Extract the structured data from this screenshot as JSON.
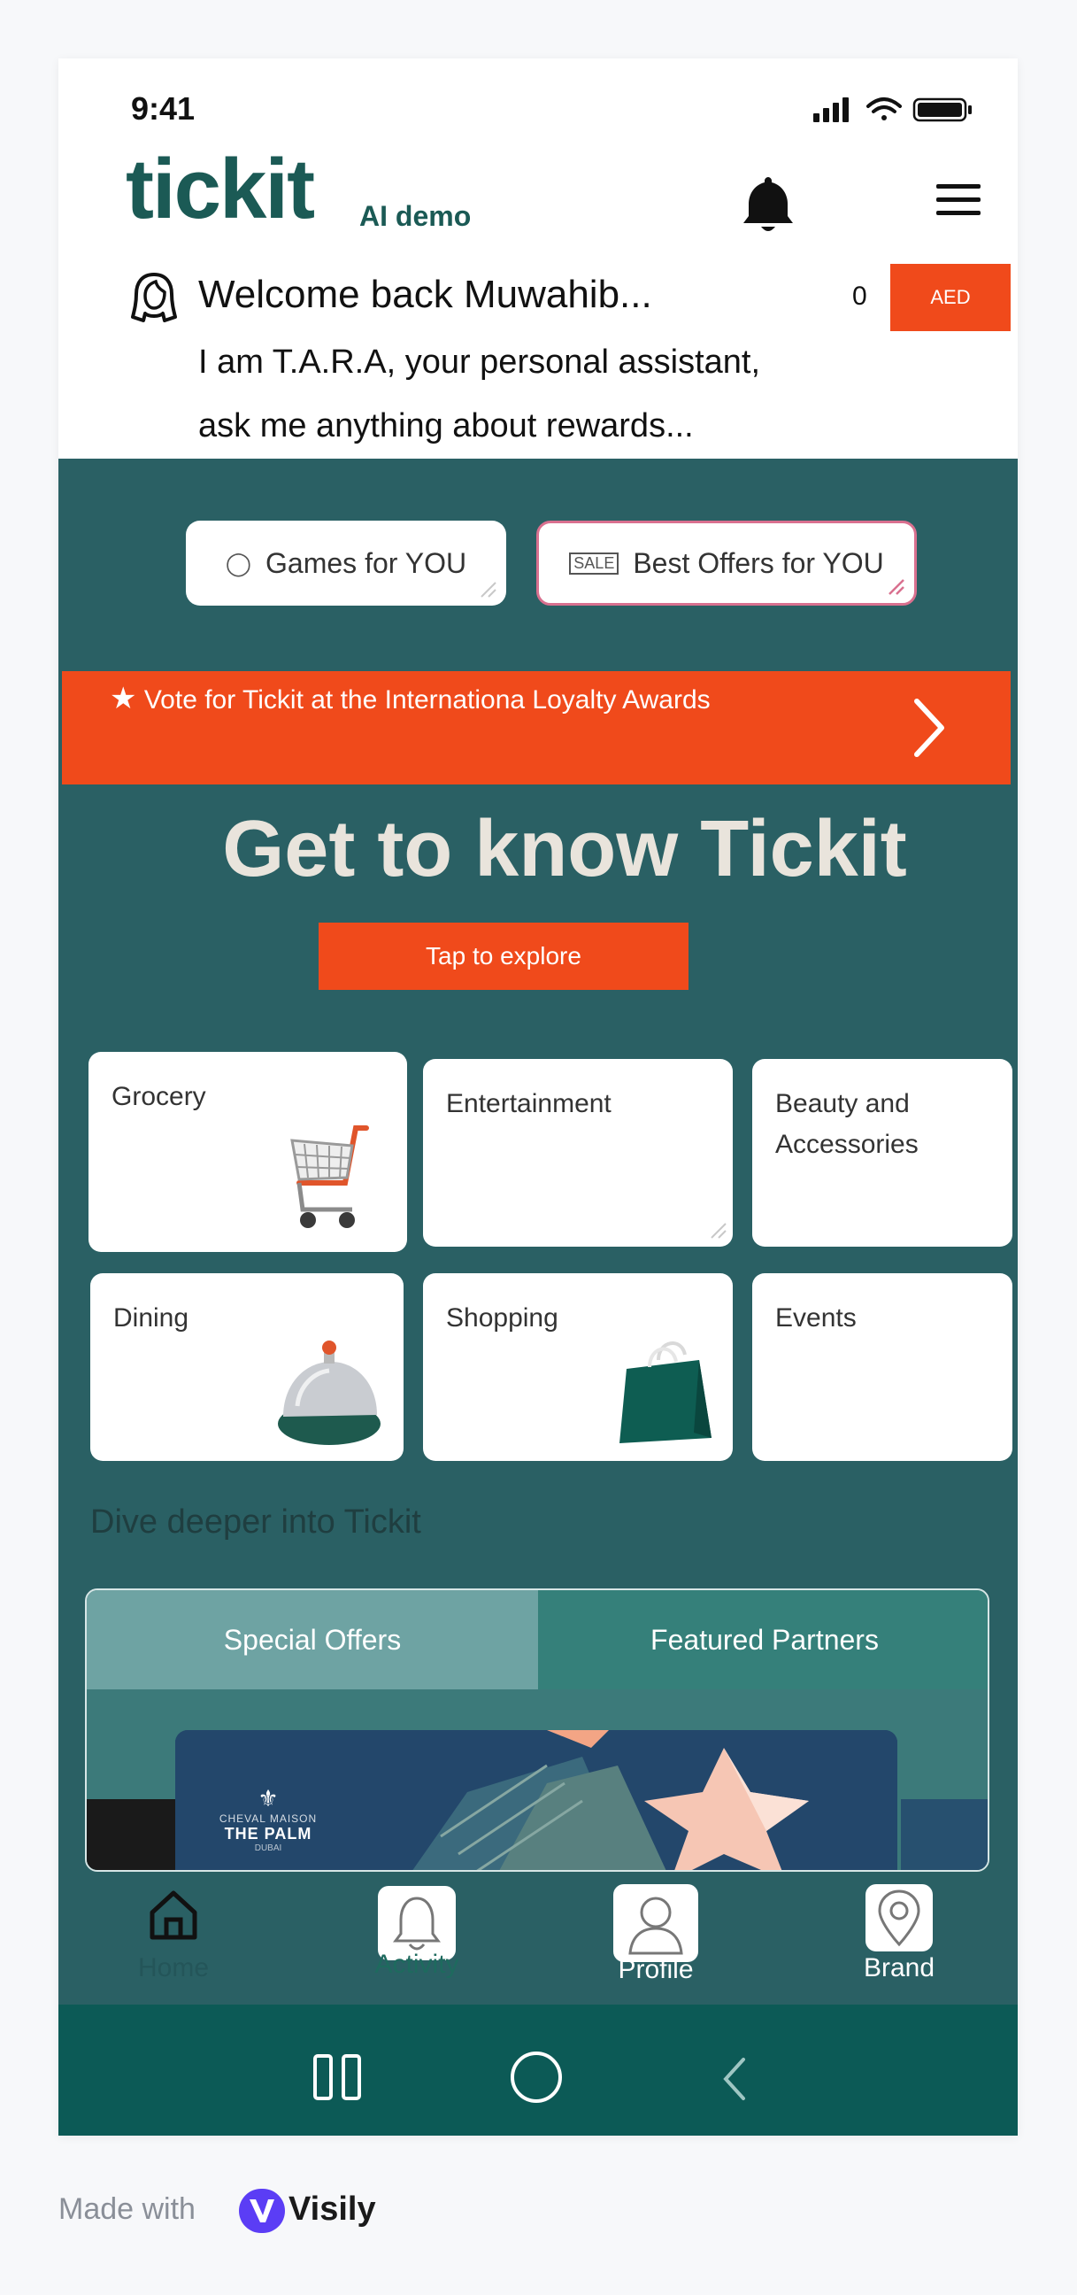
{
  "status_bar": {
    "time": "9:41"
  },
  "header": {
    "logo": "tickit",
    "logo_sub": "AI demo",
    "welcome": "Welcome back Muwahib...",
    "coin_count": "0",
    "currency_button": "AED",
    "assistant_line1": "I am T.A.R.A, your personal assistant,",
    "assistant_line2": "ask me anything about rewards..."
  },
  "quick_actions": [
    {
      "label": "Games for YOU",
      "icon": "gamepad-icon"
    },
    {
      "label": "Best Offers for YOU",
      "icon": "sale-tag-icon"
    }
  ],
  "vote_banner": {
    "text": "Vote for Tickit at the Internationa Loyalty Awards"
  },
  "hero": {
    "title": "Get to know Tickit",
    "cta": "Tap to explore"
  },
  "categories": [
    {
      "label": "Grocery",
      "icon": "shopping-cart-icon"
    },
    {
      "label": "Entertainment",
      "icon": ""
    },
    {
      "label": "Beauty and Accessories",
      "icon": ""
    },
    {
      "label": "Dining",
      "icon": "service-bell-icon"
    },
    {
      "label": "Shopping",
      "icon": "shopping-bag-icon"
    },
    {
      "label": "Events",
      "icon": ""
    }
  ],
  "deeper": {
    "title": "Dive deeper into Tickit",
    "tabs": [
      "Special Offers",
      "Featured Partners"
    ],
    "banner_brand_line1": "CHEVAL MAISON",
    "banner_brand_line2": "THE PALM",
    "banner_brand_line3": "DUBAI"
  },
  "bottom_nav": [
    {
      "label": "Home",
      "icon": "home-icon"
    },
    {
      "label": "Activity",
      "icon": "bell-icon"
    },
    {
      "label": "Profile",
      "icon": "user-icon"
    },
    {
      "label": "Brand",
      "icon": "map-pin-icon"
    }
  ],
  "footer": {
    "made_with": "Made with",
    "brand": "Visily"
  },
  "colors": {
    "teal": "#2a6064",
    "accent": "#f04a1b",
    "dark_teal": "#1b5a55",
    "system_bar": "#0c5a56"
  }
}
